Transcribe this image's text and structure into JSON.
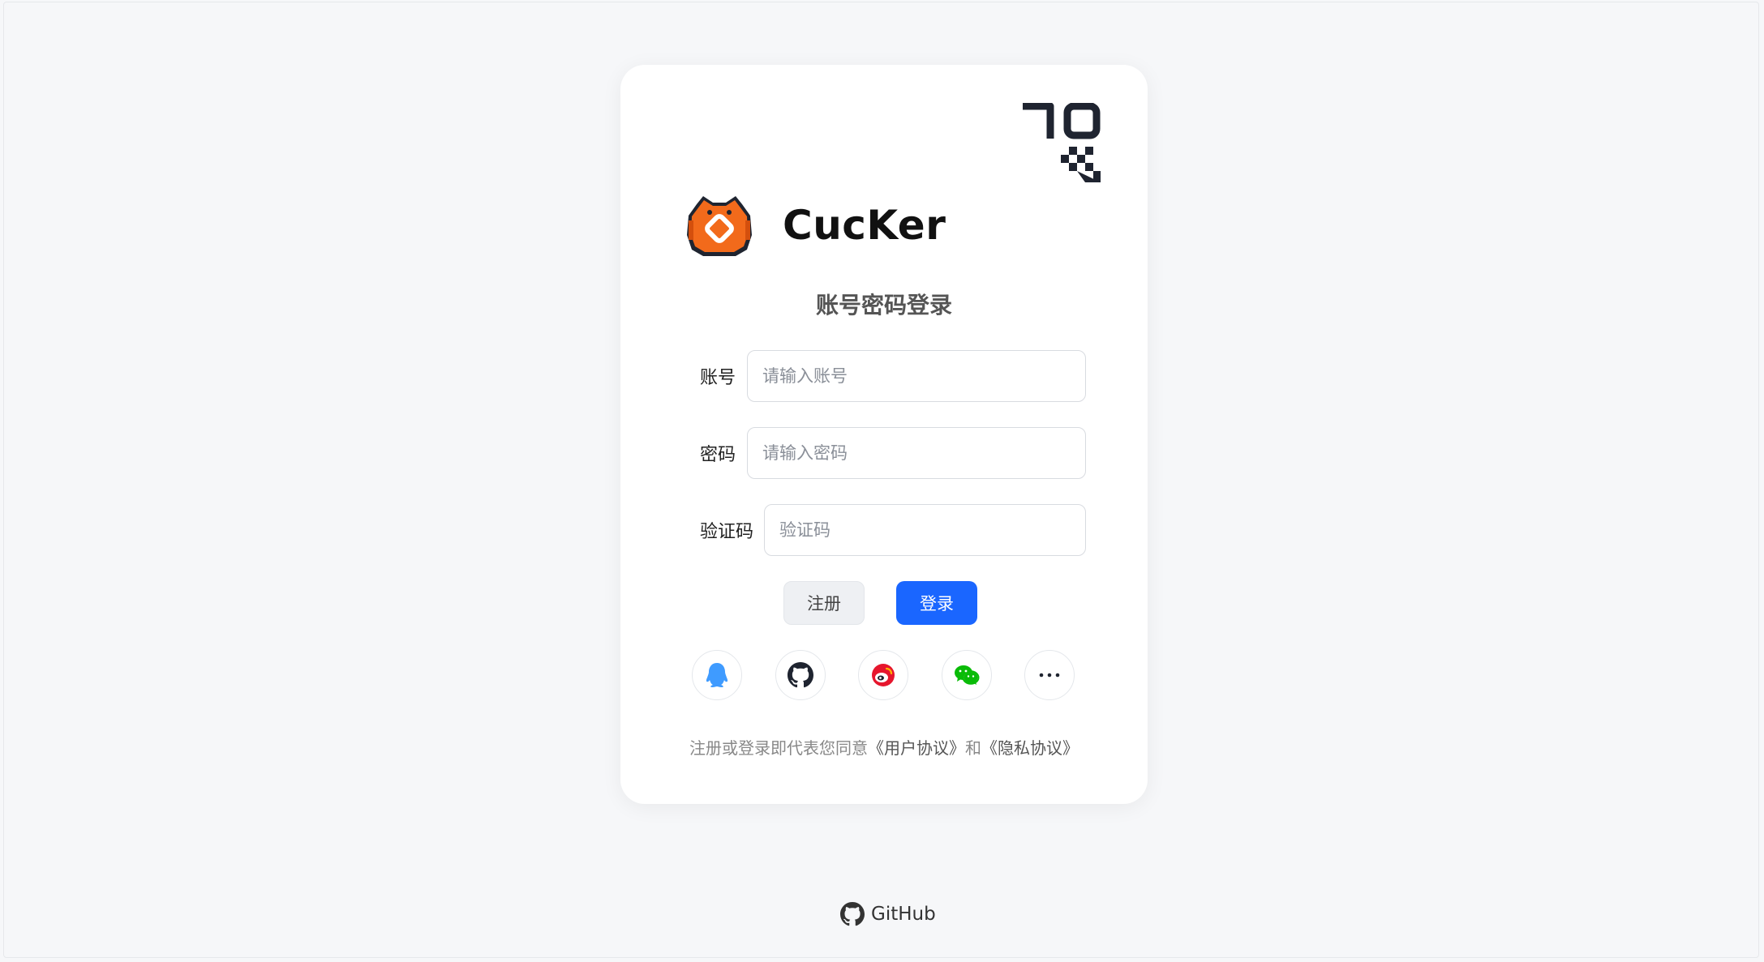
{
  "app": {
    "name": "CucKer"
  },
  "login": {
    "title": "账号密码登录",
    "account_label": "账号",
    "account_placeholder": "请输入账号",
    "password_label": "密码",
    "password_placeholder": "请输入密码",
    "captcha_label": "验证码",
    "captcha_placeholder": "验证码",
    "register_button": "注册",
    "login_button": "登录"
  },
  "social": [
    {
      "icon": "qq-icon"
    },
    {
      "icon": "github-icon"
    },
    {
      "icon": "weibo-icon"
    },
    {
      "icon": "wechat-icon"
    },
    {
      "icon": "more-icon"
    }
  ],
  "agreement": {
    "prefix": "注册或登录即代表您同意",
    "user_agreement": "《用户协议》",
    "conjunction": "和",
    "privacy_agreement": "《隐私协议》"
  },
  "footer": {
    "github_label": "GitHub"
  },
  "colors": {
    "primary": "#1a66ff",
    "background": "#f6f7f9",
    "qq": "#3f9bff",
    "weibo": "#e6162d",
    "wechat": "#09bb07",
    "logo_orange": "#f26a1b"
  }
}
